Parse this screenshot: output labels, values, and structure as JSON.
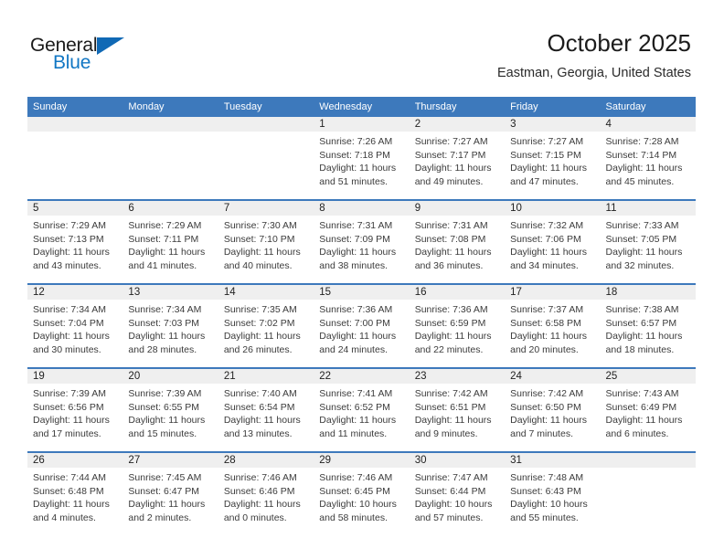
{
  "brand": {
    "name_part1": "General",
    "name_part2": "Blue",
    "triangle_icon": "triangle-icon",
    "accent_color": "#1069b5"
  },
  "header": {
    "month_title": "October 2025",
    "location": "Eastman, Georgia, United States"
  },
  "theme": {
    "header_blue": "#3d79bc",
    "daynum_band": "#efefef",
    "text": "#3b3b3b"
  },
  "weekday_headers": [
    "Sunday",
    "Monday",
    "Tuesday",
    "Wednesday",
    "Thursday",
    "Friday",
    "Saturday"
  ],
  "weeks": [
    [
      {
        "day": "",
        "empty": true,
        "sunrise": "",
        "sunset": "",
        "daylight_line1": "",
        "daylight_line2": ""
      },
      {
        "day": "",
        "empty": true,
        "sunrise": "",
        "sunset": "",
        "daylight_line1": "",
        "daylight_line2": ""
      },
      {
        "day": "",
        "empty": true,
        "sunrise": "",
        "sunset": "",
        "daylight_line1": "",
        "daylight_line2": ""
      },
      {
        "day": "1",
        "empty": false,
        "sunrise": "Sunrise: 7:26 AM",
        "sunset": "Sunset: 7:18 PM",
        "daylight_line1": "Daylight: 11 hours",
        "daylight_line2": "and 51 minutes."
      },
      {
        "day": "2",
        "empty": false,
        "sunrise": "Sunrise: 7:27 AM",
        "sunset": "Sunset: 7:17 PM",
        "daylight_line1": "Daylight: 11 hours",
        "daylight_line2": "and 49 minutes."
      },
      {
        "day": "3",
        "empty": false,
        "sunrise": "Sunrise: 7:27 AM",
        "sunset": "Sunset: 7:15 PM",
        "daylight_line1": "Daylight: 11 hours",
        "daylight_line2": "and 47 minutes."
      },
      {
        "day": "4",
        "empty": false,
        "sunrise": "Sunrise: 7:28 AM",
        "sunset": "Sunset: 7:14 PM",
        "daylight_line1": "Daylight: 11 hours",
        "daylight_line2": "and 45 minutes."
      }
    ],
    [
      {
        "day": "5",
        "empty": false,
        "sunrise": "Sunrise: 7:29 AM",
        "sunset": "Sunset: 7:13 PM",
        "daylight_line1": "Daylight: 11 hours",
        "daylight_line2": "and 43 minutes."
      },
      {
        "day": "6",
        "empty": false,
        "sunrise": "Sunrise: 7:29 AM",
        "sunset": "Sunset: 7:11 PM",
        "daylight_line1": "Daylight: 11 hours",
        "daylight_line2": "and 41 minutes."
      },
      {
        "day": "7",
        "empty": false,
        "sunrise": "Sunrise: 7:30 AM",
        "sunset": "Sunset: 7:10 PM",
        "daylight_line1": "Daylight: 11 hours",
        "daylight_line2": "and 40 minutes."
      },
      {
        "day": "8",
        "empty": false,
        "sunrise": "Sunrise: 7:31 AM",
        "sunset": "Sunset: 7:09 PM",
        "daylight_line1": "Daylight: 11 hours",
        "daylight_line2": "and 38 minutes."
      },
      {
        "day": "9",
        "empty": false,
        "sunrise": "Sunrise: 7:31 AM",
        "sunset": "Sunset: 7:08 PM",
        "daylight_line1": "Daylight: 11 hours",
        "daylight_line2": "and 36 minutes."
      },
      {
        "day": "10",
        "empty": false,
        "sunrise": "Sunrise: 7:32 AM",
        "sunset": "Sunset: 7:06 PM",
        "daylight_line1": "Daylight: 11 hours",
        "daylight_line2": "and 34 minutes."
      },
      {
        "day": "11",
        "empty": false,
        "sunrise": "Sunrise: 7:33 AM",
        "sunset": "Sunset: 7:05 PM",
        "daylight_line1": "Daylight: 11 hours",
        "daylight_line2": "and 32 minutes."
      }
    ],
    [
      {
        "day": "12",
        "empty": false,
        "sunrise": "Sunrise: 7:34 AM",
        "sunset": "Sunset: 7:04 PM",
        "daylight_line1": "Daylight: 11 hours",
        "daylight_line2": "and 30 minutes."
      },
      {
        "day": "13",
        "empty": false,
        "sunrise": "Sunrise: 7:34 AM",
        "sunset": "Sunset: 7:03 PM",
        "daylight_line1": "Daylight: 11 hours",
        "daylight_line2": "and 28 minutes."
      },
      {
        "day": "14",
        "empty": false,
        "sunrise": "Sunrise: 7:35 AM",
        "sunset": "Sunset: 7:02 PM",
        "daylight_line1": "Daylight: 11 hours",
        "daylight_line2": "and 26 minutes."
      },
      {
        "day": "15",
        "empty": false,
        "sunrise": "Sunrise: 7:36 AM",
        "sunset": "Sunset: 7:00 PM",
        "daylight_line1": "Daylight: 11 hours",
        "daylight_line2": "and 24 minutes."
      },
      {
        "day": "16",
        "empty": false,
        "sunrise": "Sunrise: 7:36 AM",
        "sunset": "Sunset: 6:59 PM",
        "daylight_line1": "Daylight: 11 hours",
        "daylight_line2": "and 22 minutes."
      },
      {
        "day": "17",
        "empty": false,
        "sunrise": "Sunrise: 7:37 AM",
        "sunset": "Sunset: 6:58 PM",
        "daylight_line1": "Daylight: 11 hours",
        "daylight_line2": "and 20 minutes."
      },
      {
        "day": "18",
        "empty": false,
        "sunrise": "Sunrise: 7:38 AM",
        "sunset": "Sunset: 6:57 PM",
        "daylight_line1": "Daylight: 11 hours",
        "daylight_line2": "and 18 minutes."
      }
    ],
    [
      {
        "day": "19",
        "empty": false,
        "sunrise": "Sunrise: 7:39 AM",
        "sunset": "Sunset: 6:56 PM",
        "daylight_line1": "Daylight: 11 hours",
        "daylight_line2": "and 17 minutes."
      },
      {
        "day": "20",
        "empty": false,
        "sunrise": "Sunrise: 7:39 AM",
        "sunset": "Sunset: 6:55 PM",
        "daylight_line1": "Daylight: 11 hours",
        "daylight_line2": "and 15 minutes."
      },
      {
        "day": "21",
        "empty": false,
        "sunrise": "Sunrise: 7:40 AM",
        "sunset": "Sunset: 6:54 PM",
        "daylight_line1": "Daylight: 11 hours",
        "daylight_line2": "and 13 minutes."
      },
      {
        "day": "22",
        "empty": false,
        "sunrise": "Sunrise: 7:41 AM",
        "sunset": "Sunset: 6:52 PM",
        "daylight_line1": "Daylight: 11 hours",
        "daylight_line2": "and 11 minutes."
      },
      {
        "day": "23",
        "empty": false,
        "sunrise": "Sunrise: 7:42 AM",
        "sunset": "Sunset: 6:51 PM",
        "daylight_line1": "Daylight: 11 hours",
        "daylight_line2": "and 9 minutes."
      },
      {
        "day": "24",
        "empty": false,
        "sunrise": "Sunrise: 7:42 AM",
        "sunset": "Sunset: 6:50 PM",
        "daylight_line1": "Daylight: 11 hours",
        "daylight_line2": "and 7 minutes."
      },
      {
        "day": "25",
        "empty": false,
        "sunrise": "Sunrise: 7:43 AM",
        "sunset": "Sunset: 6:49 PM",
        "daylight_line1": "Daylight: 11 hours",
        "daylight_line2": "and 6 minutes."
      }
    ],
    [
      {
        "day": "26",
        "empty": false,
        "sunrise": "Sunrise: 7:44 AM",
        "sunset": "Sunset: 6:48 PM",
        "daylight_line1": "Daylight: 11 hours",
        "daylight_line2": "and 4 minutes."
      },
      {
        "day": "27",
        "empty": false,
        "sunrise": "Sunrise: 7:45 AM",
        "sunset": "Sunset: 6:47 PM",
        "daylight_line1": "Daylight: 11 hours",
        "daylight_line2": "and 2 minutes."
      },
      {
        "day": "28",
        "empty": false,
        "sunrise": "Sunrise: 7:46 AM",
        "sunset": "Sunset: 6:46 PM",
        "daylight_line1": "Daylight: 11 hours",
        "daylight_line2": "and 0 minutes."
      },
      {
        "day": "29",
        "empty": false,
        "sunrise": "Sunrise: 7:46 AM",
        "sunset": "Sunset: 6:45 PM",
        "daylight_line1": "Daylight: 10 hours",
        "daylight_line2": "and 58 minutes."
      },
      {
        "day": "30",
        "empty": false,
        "sunrise": "Sunrise: 7:47 AM",
        "sunset": "Sunset: 6:44 PM",
        "daylight_line1": "Daylight: 10 hours",
        "daylight_line2": "and 57 minutes."
      },
      {
        "day": "31",
        "empty": false,
        "sunrise": "Sunrise: 7:48 AM",
        "sunset": "Sunset: 6:43 PM",
        "daylight_line1": "Daylight: 10 hours",
        "daylight_line2": "and 55 minutes."
      },
      {
        "day": "",
        "empty": true,
        "sunrise": "",
        "sunset": "",
        "daylight_line1": "",
        "daylight_line2": ""
      }
    ]
  ]
}
